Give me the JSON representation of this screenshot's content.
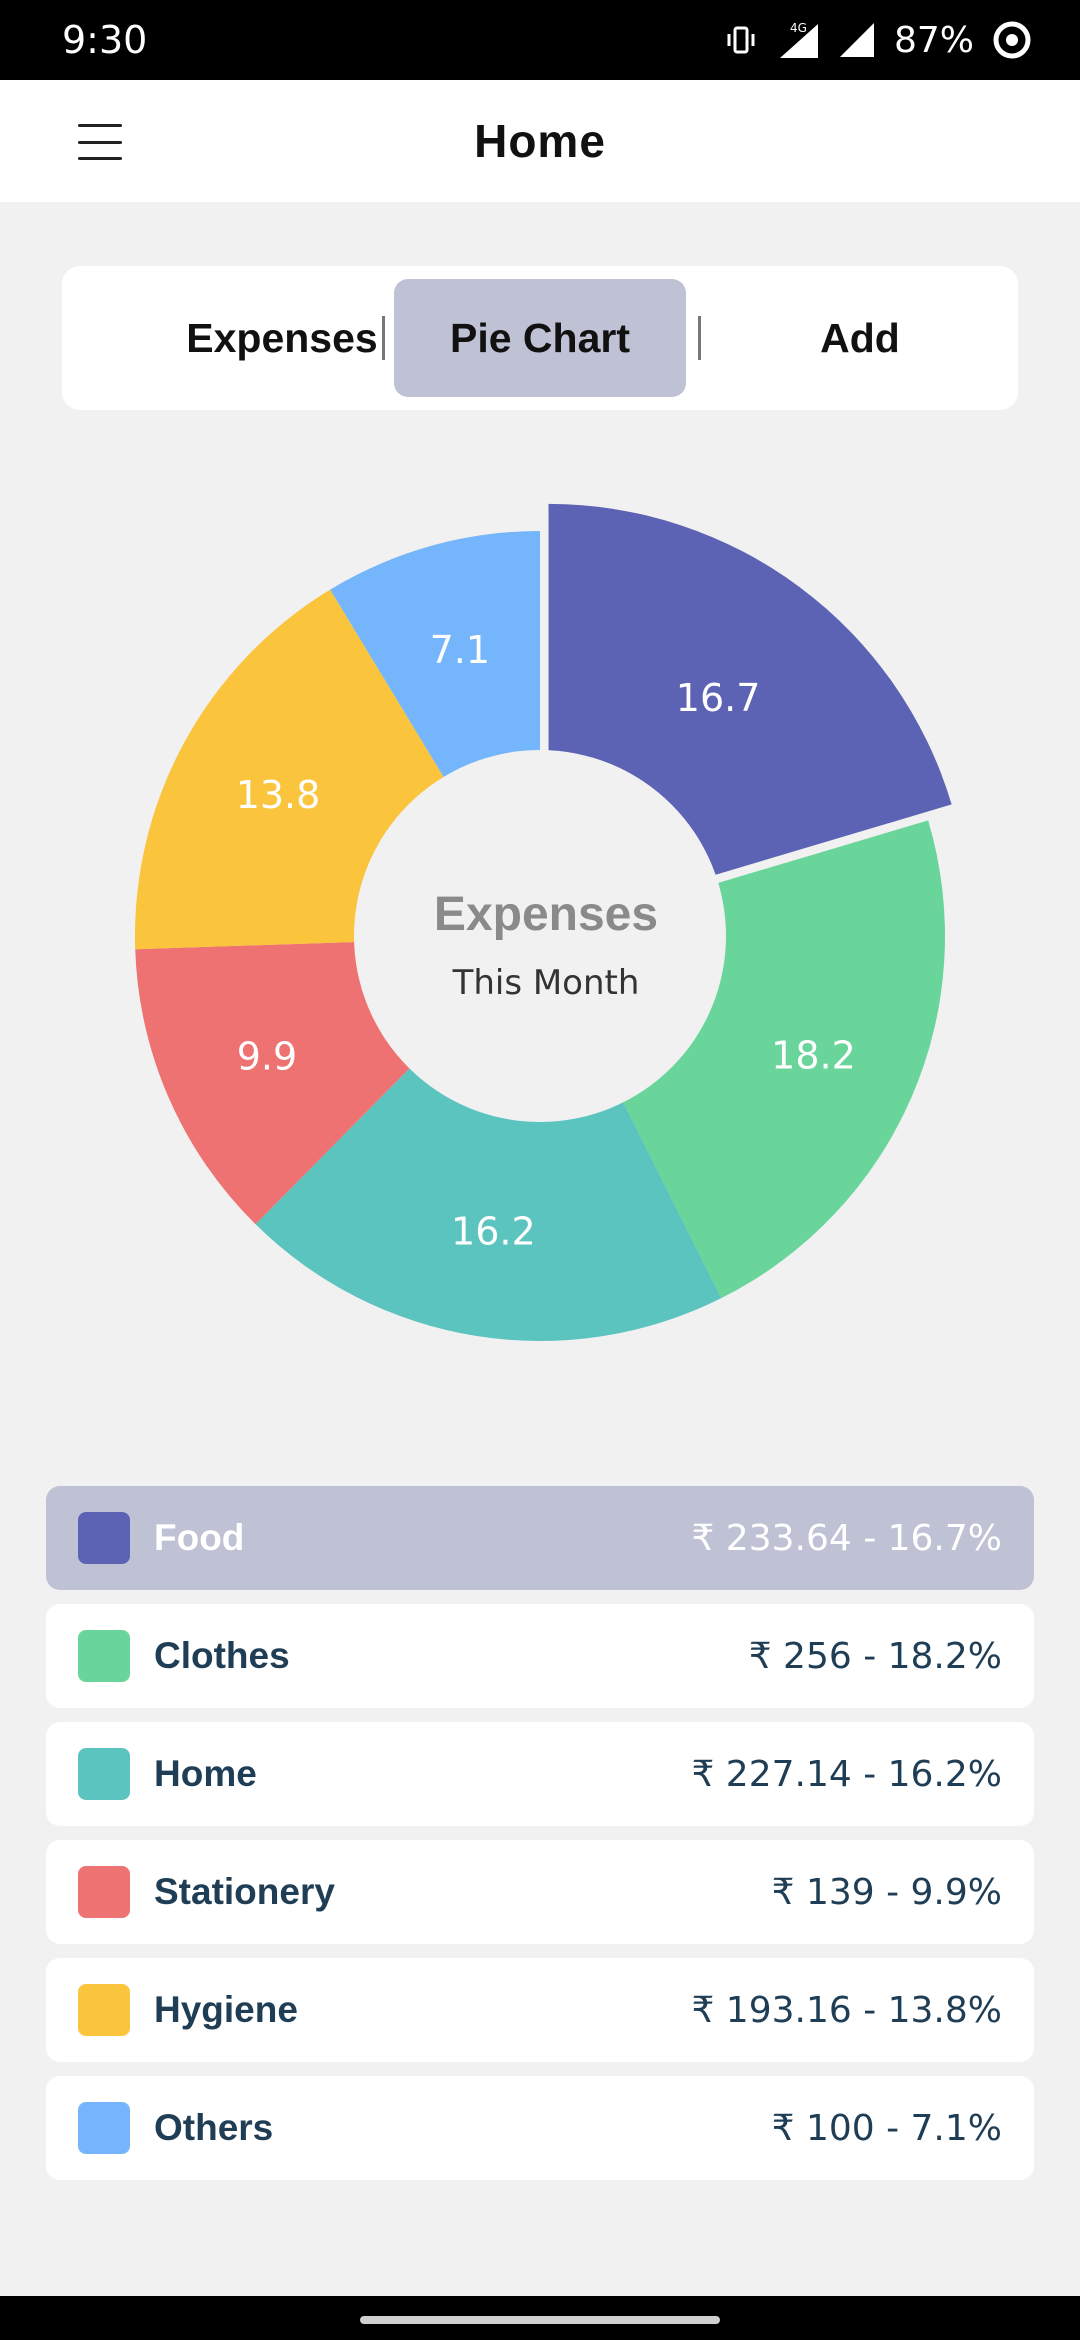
{
  "status": {
    "time": "9:30",
    "network": "4G",
    "battery": "87%"
  },
  "app_bar": {
    "title": "Home",
    "menu_icon": "hamburger-menu-icon"
  },
  "tabs": [
    {
      "label": "Expenses",
      "active": false
    },
    {
      "label": "Pie Chart",
      "active": true
    },
    {
      "label": "Add",
      "active": false
    }
  ],
  "chart_data": {
    "type": "pie",
    "donut": true,
    "center_title": "Expenses",
    "center_subtitle": "This Month",
    "start_angle_deg": 0,
    "selected_index": 0,
    "slices": [
      {
        "label": "Food",
        "value": 16.7,
        "data_label": "16.7",
        "color": "#5c62b4"
      },
      {
        "label": "Clothes",
        "value": 18.2,
        "data_label": "18.2",
        "color": "#6ad59a"
      },
      {
        "label": "Home",
        "value": 16.2,
        "data_label": "16.2",
        "color": "#5bc4bf"
      },
      {
        "label": "Stationery",
        "value": 9.9,
        "data_label": "9.9",
        "color": "#ee7272"
      },
      {
        "label": "Hygiene",
        "value": 13.8,
        "data_label": "13.8",
        "color": "#fac43c"
      },
      {
        "label": "Others",
        "value": 7.1,
        "data_label": "7.1",
        "color": "#74b5fb"
      }
    ]
  },
  "legend": [
    {
      "name": "Food",
      "amount": "₹ 233.64 - 16.7%",
      "color": "#5c62b4",
      "selected": true
    },
    {
      "name": "Clothes",
      "amount": "₹ 256 - 18.2%",
      "color": "#6ad59a",
      "selected": false
    },
    {
      "name": "Home",
      "amount": "₹ 227.14 - 16.2%",
      "color": "#5bc4bf",
      "selected": false
    },
    {
      "name": "Stationery",
      "amount": "₹ 139 - 9.9%",
      "color": "#ee7272",
      "selected": false
    },
    {
      "name": "Hygiene",
      "amount": "₹ 193.16 - 13.8%",
      "color": "#fac43c",
      "selected": false
    },
    {
      "name": "Others",
      "amount": "₹ 100 - 7.1%",
      "color": "#74b5fb",
      "selected": false
    }
  ]
}
